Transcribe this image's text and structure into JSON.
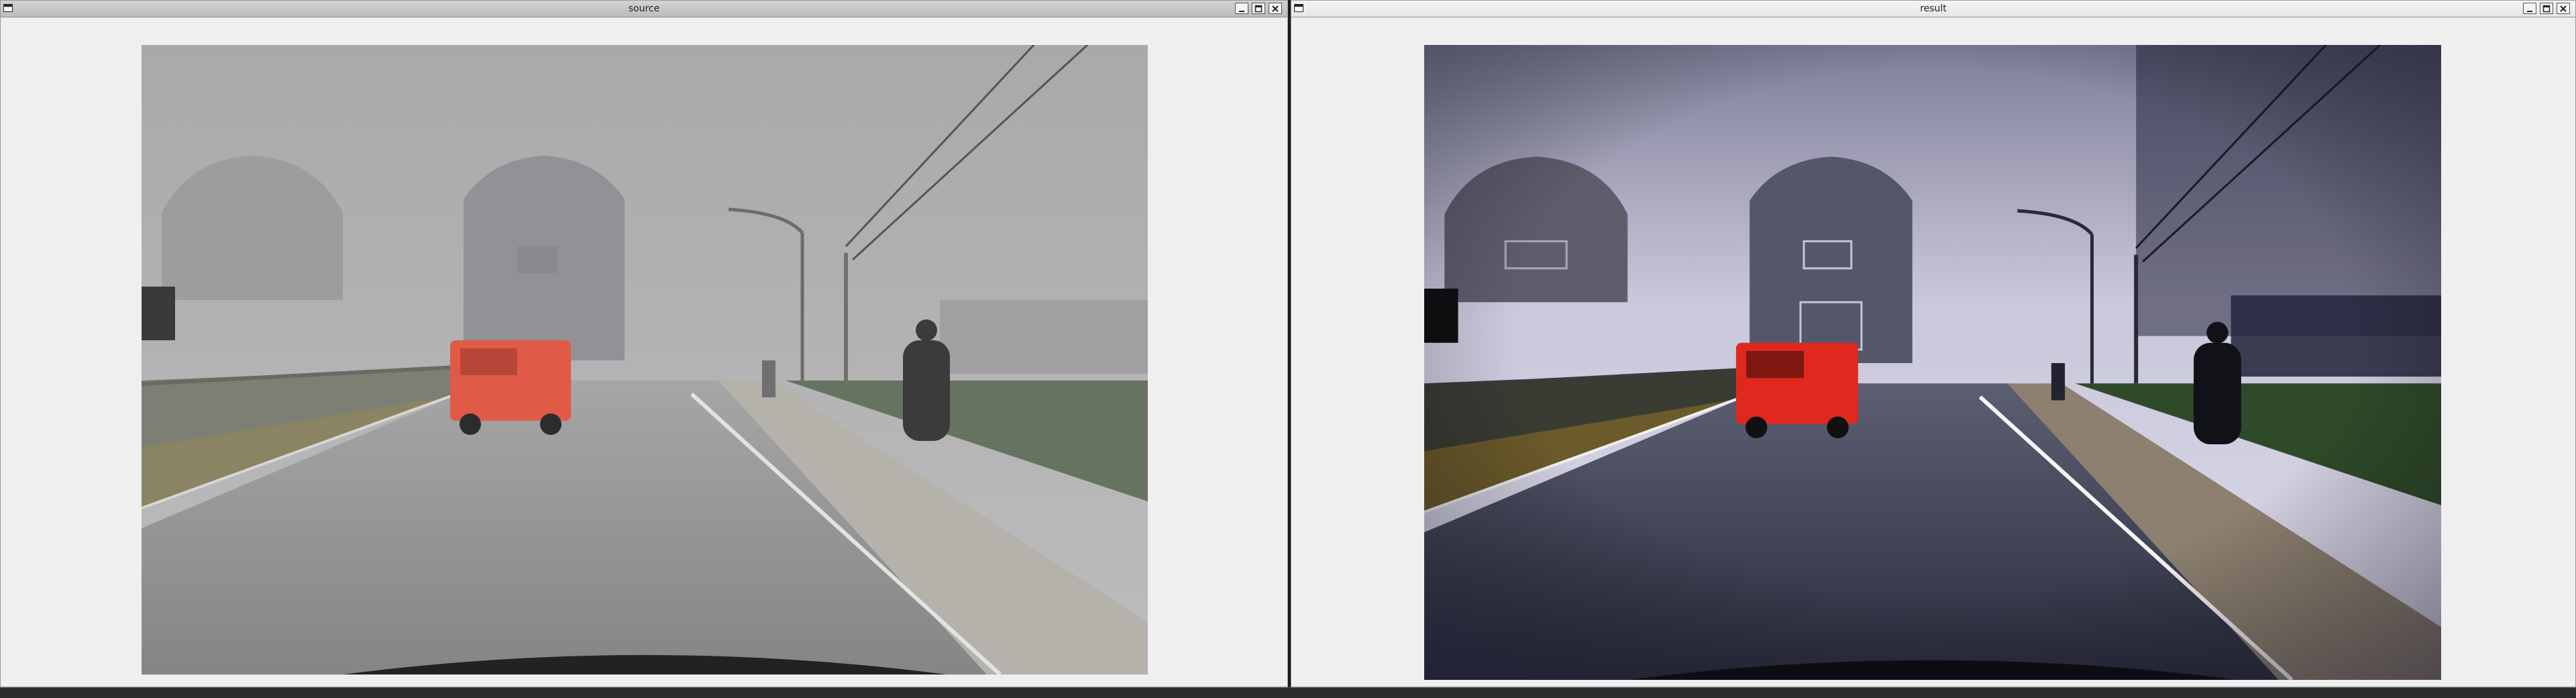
{
  "windows": {
    "source": {
      "title": "source"
    },
    "result": {
      "title": "result"
    }
  },
  "icons": {
    "system_menu": "window-menu-icon",
    "minimize": "minimize-icon",
    "maximize": "maximize-icon",
    "close": "close-icon"
  },
  "colors": {
    "titlebar_source": "#c8c8c8",
    "titlebar_result": "#ececec",
    "window_background": "#efefef"
  }
}
